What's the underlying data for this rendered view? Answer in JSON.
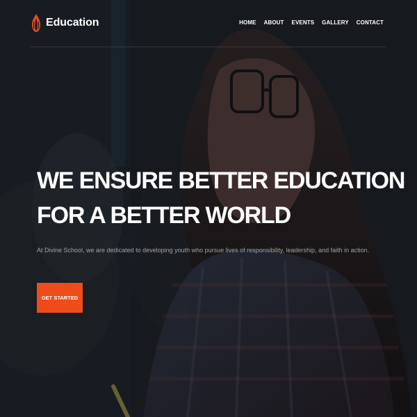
{
  "brand": {
    "name": "Education",
    "icon": "flame-logo-icon",
    "accent_color": "#f04c1a"
  },
  "nav": {
    "items": [
      {
        "label": "HOME"
      },
      {
        "label": "ABOUT"
      },
      {
        "label": "EVENTS"
      },
      {
        "label": "GALLERY"
      },
      {
        "label": "CONTACT"
      }
    ]
  },
  "hero": {
    "headline_line1": "WE ENSURE BETTER EDUCATION",
    "headline_line2": "FOR A BETTER WORLD",
    "subtext": "At Divine School, we are dedicated to developing youth who pursue lives of responsibility, leadership, and faith in action.",
    "cta_label": "GET STARTED",
    "cta_color": "#f04c1a"
  }
}
